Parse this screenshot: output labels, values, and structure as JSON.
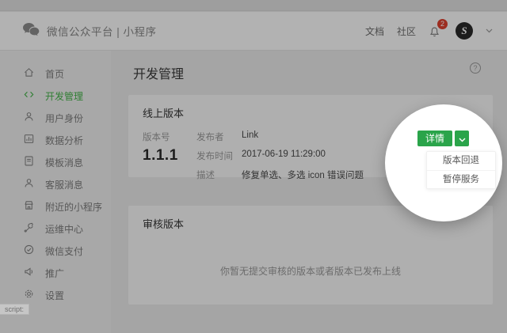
{
  "header": {
    "title": "微信公众平台 | 小程序",
    "nav_docs": "文档",
    "nav_community": "社区",
    "notification_count": "2",
    "avatar_letter": "S"
  },
  "sidebar": {
    "active_index": 1,
    "items": [
      {
        "label": "首页",
        "icon": "home-icon"
      },
      {
        "label": "开发管理",
        "icon": "code-icon"
      },
      {
        "label": "用户身份",
        "icon": "user-icon"
      },
      {
        "label": "数据分析",
        "icon": "bar-chart-icon"
      },
      {
        "label": "模板消息",
        "icon": "template-message-icon"
      },
      {
        "label": "客服消息",
        "icon": "customer-service-icon"
      },
      {
        "label": "附近的小程序",
        "icon": "nearby-shop-icon"
      },
      {
        "label": "运维中心",
        "icon": "wrench-icon"
      },
      {
        "label": "微信支付",
        "icon": "wechat-pay-icon"
      },
      {
        "label": "推广",
        "icon": "megaphone-icon"
      },
      {
        "label": "设置",
        "icon": "gear-icon"
      }
    ]
  },
  "main": {
    "page_title": "开发管理",
    "help_glyph": "?",
    "online_version": {
      "section_title": "线上版本",
      "version_label": "版本号",
      "version_value": "1.1.1",
      "publisher_label": "发布者",
      "publisher_value": "Link",
      "time_label": "发布时间",
      "time_value": "2017-06-19 11:29:00",
      "desc_label": "描述",
      "desc_value": "修复单选、多选 icon 错误问题",
      "detail_button_label": "详情",
      "dropdown_items": [
        "版本回退",
        "暂停服务"
      ]
    },
    "review_version": {
      "section_title": "审核版本",
      "empty_text": "你暂无提交审核的版本或者版本已发布上线"
    }
  },
  "status_bar": {
    "text": "script:"
  },
  "colors": {
    "accent_green": "#2aa44a",
    "sidebar_active_green": "#44b549",
    "badge_red": "#e0412f"
  }
}
